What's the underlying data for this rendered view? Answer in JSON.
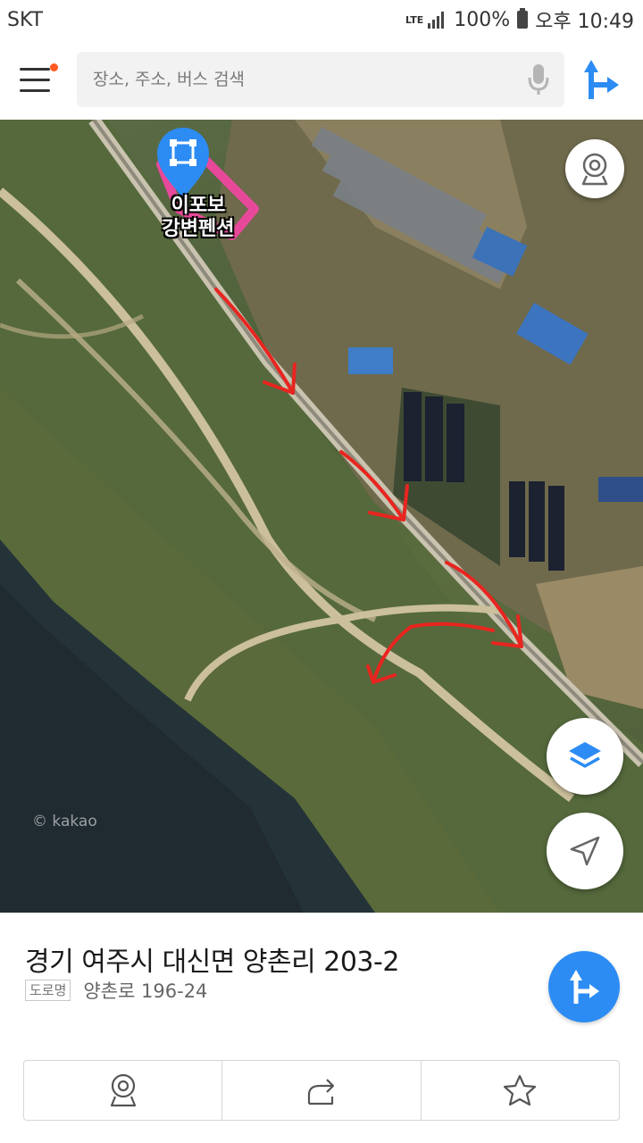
{
  "status_bar": {
    "carrier": "SKT",
    "network": "LTE",
    "battery": "100%",
    "time": "오후 10:49"
  },
  "search": {
    "placeholder": "장소, 주소, 버스 검색"
  },
  "map": {
    "place_label_line1": "이포보",
    "place_label_line2": "강변펜션",
    "watermark": "© kakao"
  },
  "place": {
    "address": "경기 여주시 대신면 양촌리 203-2",
    "road_tag": "도로명",
    "road_address": "양촌로 196-24"
  },
  "icons": {
    "menu": "menu-icon",
    "mic": "mic-icon",
    "directions": "directions-icon",
    "roadview": "roadview-icon",
    "layers": "layers-icon",
    "location": "location-arrow-icon",
    "share": "share-icon",
    "star": "star-icon"
  },
  "colors": {
    "accent": "#2c8cf4",
    "menu_badge": "#ff5a1f",
    "area_outline": "#e8489a",
    "annotation_arrows": "#e8251f"
  }
}
